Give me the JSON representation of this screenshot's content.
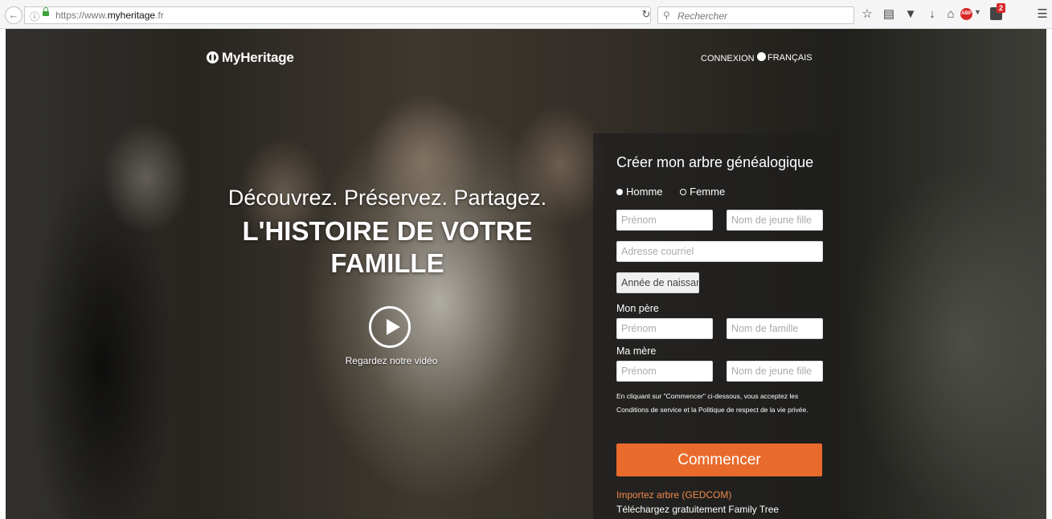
{
  "browser": {
    "url_prefix": "https://www.",
    "url_domain": "myheritage",
    "url_suffix": ".fr",
    "search_placeholder": "Rechercher",
    "icons": [
      "back-arrow",
      "info",
      "lock",
      "reload",
      "search",
      "star",
      "reading-list",
      "pocket",
      "download",
      "home",
      "adblock",
      "extension",
      "menu"
    ],
    "extension_badge": "2"
  },
  "header": {
    "logo": "MyHeritage",
    "login": "CONNEXION",
    "language": "FRANÇAIS"
  },
  "hero": {
    "tagline": "Découvrez. Préservez. Partagez.",
    "headline": "L'HISTOIRE DE VOTRE FAMILLE",
    "video_link": "Regardez notre vidéo"
  },
  "form": {
    "title": "Créer mon arbre généalogique",
    "gender_male": "Homme",
    "gender_female": "Femme",
    "selected_gender": "Homme",
    "first_name_ph": "Prénom",
    "maiden_name_ph": "Nom de jeune fille",
    "email_ph": "Adresse courriel",
    "birth_year_value": "Année de naissar",
    "father_label": "Mon père",
    "father_first_ph": "Prénom",
    "father_last_ph": "Nom de famille",
    "mother_label": "Ma mère",
    "mother_first_ph": "Prénom",
    "mother_maiden_ph": "Nom de jeune fille",
    "terms": "En cliquant sur \"Commencer\" ci-dessous, vous acceptez les Conditions de service et la Politique de respect de la vie privée.",
    "submit": "Commencer",
    "import_link": "Importez arbre (GEDCOM)",
    "download_text": "Téléchargez gratuitement Family Tree"
  },
  "colors": {
    "accent": "#e96b2c",
    "import_link": "#f08a4b",
    "adblock": "#d9282a"
  }
}
